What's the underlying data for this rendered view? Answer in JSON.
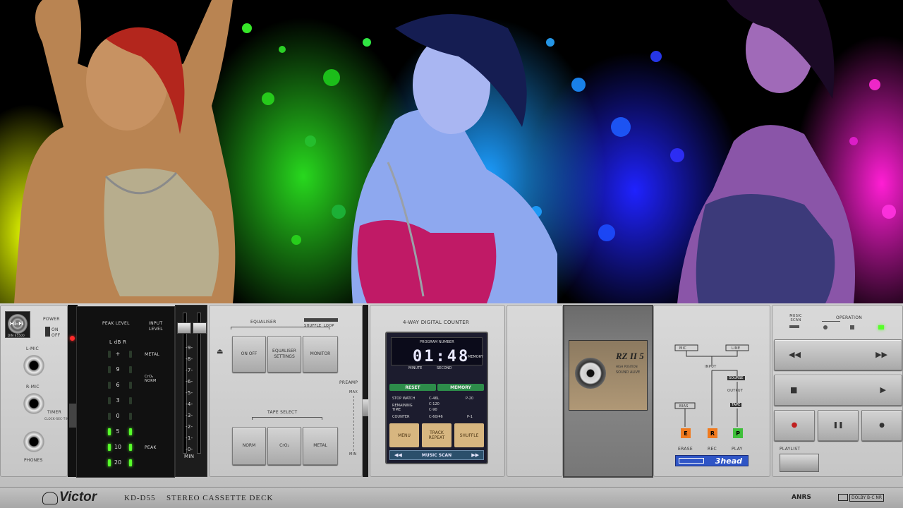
{
  "deck": {
    "brand": "Victor",
    "model": "KD-D55",
    "type": "STEREO CASSETTE DECK",
    "anrs": "ANRS",
    "dolby": "DOLBY B-C NR"
  },
  "left": {
    "hifi_badge": "Hi-Fi",
    "din": "DIN 45500",
    "power": "POWER",
    "on": "ON",
    "off": "OFF",
    "lmic": "L-MIC",
    "rmic": "R-MIC",
    "timer": "TIMER",
    "timer_sub": "CLOCK·SEC·TIME",
    "phones": "PHONES"
  },
  "meter": {
    "peak_level": "PEAK LEVEL",
    "input_level": "INPUT LEVEL",
    "ldb": "L dB R",
    "scale": [
      "+",
      "9",
      "6",
      "3",
      "0",
      "5",
      "10",
      "20"
    ],
    "metal": "METAL",
    "crnorm": "CrO₂ NORM",
    "peak": "PEAK",
    "input_scale": [
      "0",
      "1",
      "2",
      "3",
      "4",
      "5",
      "6",
      "7",
      "8",
      "9"
    ],
    "min": "MIN"
  },
  "equaliser": {
    "label": "EQUALISER",
    "shuffle": "SHUFFLE",
    "loop": "LOOP",
    "on_off": "ON OFF",
    "settings": "EQUALISER SETTINGS",
    "monitor": "MONITOR",
    "tape_select": "TAPE SELECT",
    "norm": "NORM",
    "cro2": "CrO₂",
    "metal": "METAL",
    "preamp": "PREAMP",
    "max": "MAX",
    "min": "MIN"
  },
  "counter": {
    "title": "4-WAY DIGITAL COUNTER",
    "program_number": "PROGRAM NUMBER",
    "time": "01:48",
    "minute": "MINUTE",
    "second": "SECOND",
    "memory_flag": "MEMORY",
    "reset": "RESET",
    "memory": "MEMORY",
    "stop_watch": "STOP WATCH",
    "remaining_time": "REMAINING TIME",
    "counter": "COUNTER",
    "c46l": "C-46L",
    "c120": "C-120",
    "c90": "C-90",
    "c6046": "C-60/46",
    "p20": "P-20",
    "p1": "P-1",
    "menu": "MENU",
    "track_repeat": "TRACK REPEAT",
    "shuffle": "SHUFFLE",
    "music_scan": "MUSIC SCAN"
  },
  "cassette": {
    "brand": "RZ II 5",
    "line1": "HIGH POSITION ",
    "line2": "SOUND ALIVE"
  },
  "path": {
    "mic": "MIC",
    "line": "LINE",
    "input": "INPUT",
    "source": "SOURSE",
    "output": "OUTPUT",
    "tape": "TAPE",
    "bias": "BIAS",
    "erase": "ERASE",
    "rec": "REC",
    "play": "PLAY",
    "e": "E",
    "r": "R",
    "p": "P",
    "head": "3head"
  },
  "transport": {
    "music_scan": "MUSIC SCAN",
    "operation": "OPERATION",
    "rew": "◀◀",
    "ff": "▶▶",
    "stop": "■",
    "play": "▶",
    "rec": "●",
    "pause": "❚❚",
    "other": "●",
    "playlist": "PLAYLIST"
  },
  "colors": {
    "accent_green": "#2d8c4a",
    "led_green": "#57ff2a",
    "led_red": "#ff2a2a",
    "badge_blue": "#2f55c6"
  }
}
